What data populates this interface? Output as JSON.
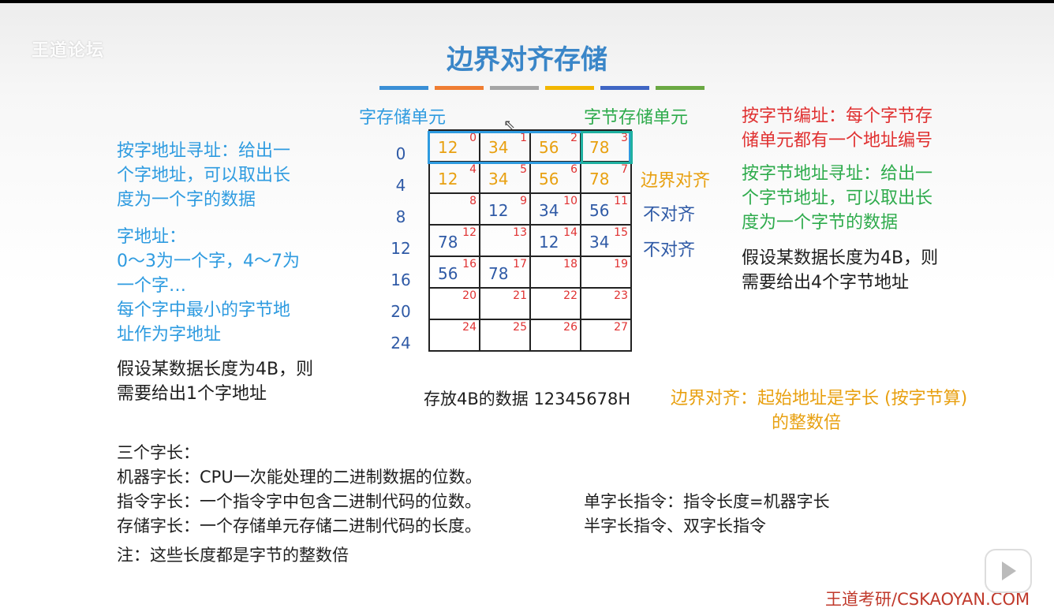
{
  "watermark": "王道论坛",
  "title": "边界对齐存储",
  "accent_bars": [
    "#3a8fd6",
    "#ef7d32",
    "#a5a5a5",
    "#f2b600",
    "#3f66c4",
    "#6aa842"
  ],
  "left": {
    "word_address": [
      "按字地址寻址：给出一",
      "个字地址，可以取出长",
      "度为一个字的数据"
    ],
    "word_addr_heading": "字地址：",
    "word_addr_desc": [
      "0～3为一个字，4～7为",
      "一个字…",
      "每个字中最小的字节地",
      "址作为字地址"
    ],
    "assume": [
      "假设某数据长度为4B，则",
      "需要给出1个字地址"
    ]
  },
  "diagram": {
    "word_unit_label": "字存储单元",
    "byte_unit_label": "字节存储单元",
    "row_labels": [
      "0",
      "4",
      "8",
      "12",
      "16",
      "20",
      "24"
    ],
    "cells": [
      [
        {
          "v": "12",
          "a": "0",
          "c": "orange"
        },
        {
          "v": "34",
          "a": "1",
          "c": "orange"
        },
        {
          "v": "56",
          "a": "2",
          "c": "orange"
        },
        {
          "v": "78",
          "a": "3",
          "c": "orange"
        }
      ],
      [
        {
          "v": "12",
          "a": "4",
          "c": "orange"
        },
        {
          "v": "34",
          "a": "5",
          "c": "orange"
        },
        {
          "v": "56",
          "a": "6",
          "c": "orange"
        },
        {
          "v": "78",
          "a": "7",
          "c": "orange"
        }
      ],
      [
        {
          "v": "",
          "a": "8",
          "c": "dblue"
        },
        {
          "v": "12",
          "a": "9",
          "c": "dblue"
        },
        {
          "v": "34",
          "a": "10",
          "c": "dblue"
        },
        {
          "v": "56",
          "a": "11",
          "c": "dblue"
        }
      ],
      [
        {
          "v": "78",
          "a": "12",
          "c": "dblue"
        },
        {
          "v": "",
          "a": "13",
          "c": "dblue"
        },
        {
          "v": "12",
          "a": "14",
          "c": "dblue"
        },
        {
          "v": "34",
          "a": "15",
          "c": "dblue"
        }
      ],
      [
        {
          "v": "56",
          "a": "16",
          "c": "dblue"
        },
        {
          "v": "78",
          "a": "17",
          "c": "dblue"
        },
        {
          "v": "",
          "a": "18",
          "c": "dblue"
        },
        {
          "v": "",
          "a": "19",
          "c": "dblue"
        }
      ],
      [
        {
          "v": "",
          "a": "20",
          "c": "dblue"
        },
        {
          "v": "",
          "a": "21",
          "c": "dblue"
        },
        {
          "v": "",
          "a": "22",
          "c": "dblue"
        },
        {
          "v": "",
          "a": "23",
          "c": "dblue"
        }
      ],
      [
        {
          "v": "",
          "a": "24",
          "c": "dblue"
        },
        {
          "v": "",
          "a": "25",
          "c": "dblue"
        },
        {
          "v": "",
          "a": "26",
          "c": "dblue"
        },
        {
          "v": "",
          "a": "27",
          "c": "dblue"
        }
      ]
    ],
    "row_notes": [
      "边界对齐",
      "不对齐",
      "不对齐"
    ],
    "caption": "存放4B的数据 12345678H"
  },
  "right": {
    "byte_numbering": [
      "按字节编址：每个字节存",
      "储单元都有一个地址编号"
    ],
    "byte_address": [
      "按字节地址寻址：给出一",
      "个字节地址，可以取出长",
      "度为一个字节的数据"
    ],
    "assume": [
      "假设某数据长度为4B，则",
      "需要给出4个字节地址"
    ],
    "alignment_def": [
      "边界对齐：起始地址是字长 (按字节算)",
      "的整数倍"
    ]
  },
  "bottom": {
    "lines": [
      "三个字长：",
      "机器字长：CPU一次能处理的二进制数据的位数。",
      "指令字长：一个指令字中包含二进制代码的位数。",
      "存储字长：一个存储单元存储二进制代码的长度。"
    ],
    "note": "注：这些长度都是字节的整数倍",
    "instr": [
      "单字长指令：指令长度=机器字长",
      "半字长指令、双字长指令"
    ]
  },
  "footer": "王道考研/CSKAOYAN.COM"
}
